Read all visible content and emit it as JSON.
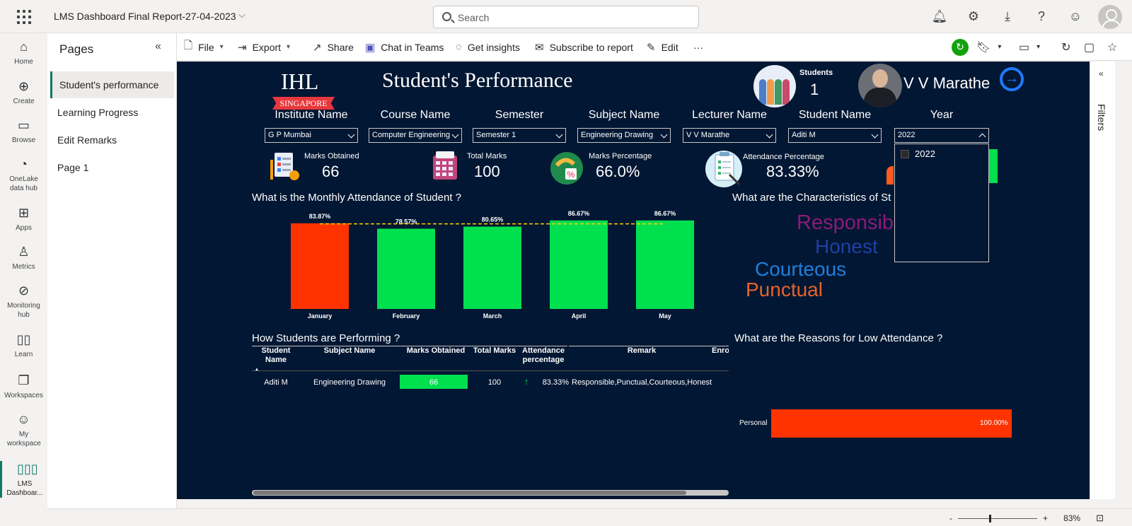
{
  "app": {
    "report_title": "LMS Dashboard Final Report-27-04-2023",
    "search_placeholder": "Search"
  },
  "leftnav": {
    "items": [
      {
        "label": "Home",
        "icon": "home-icon"
      },
      {
        "label": "Create",
        "icon": "plus-circle-icon"
      },
      {
        "label": "Browse",
        "icon": "folder-icon"
      },
      {
        "label": "OneLake data hub",
        "icon": "onelake-icon"
      },
      {
        "label": "Apps",
        "icon": "apps-icon"
      },
      {
        "label": "Metrics",
        "icon": "trophy-icon"
      },
      {
        "label": "Monitoring hub",
        "icon": "monitor-icon"
      },
      {
        "label": "Learn",
        "icon": "book-icon"
      },
      {
        "label": "Workspaces",
        "icon": "workspaces-icon"
      },
      {
        "label": "My workspace",
        "icon": "person-icon"
      },
      {
        "label": "LMS Dashboar...",
        "icon": "report-icon"
      }
    ]
  },
  "pages": {
    "title": "Pages",
    "items": [
      "Student's performance",
      "Learning Progress",
      "Edit Remarks",
      "Page 1"
    ],
    "active": 0
  },
  "actionbar": {
    "file": "File",
    "export": "Export",
    "share": "Share",
    "chat": "Chat in Teams",
    "insights": "Get insights",
    "subscribe": "Subscribe to report",
    "edit": "Edit",
    "more": "···"
  },
  "filters_pane": {
    "label": "Filters"
  },
  "status": {
    "zoom": "83%",
    "minus": "-",
    "plus": "+"
  },
  "report": {
    "logo_text": "IHL",
    "logo_ribbon": "SINGAPORE",
    "heading": "Student's Performance",
    "students_label": "Students",
    "students_value": "1",
    "lecturer_name": "V V Marathe",
    "slicers": [
      {
        "title": "Institute Name",
        "value": "G P Mumbai"
      },
      {
        "title": "Course Name",
        "value": "Computer Engineering"
      },
      {
        "title": "Semester",
        "value": "Semester 1"
      },
      {
        "title": "Subject Name",
        "value": "Engineering Drawing"
      },
      {
        "title": "Lecturer Name",
        "value": "V V Marathe"
      },
      {
        "title": "Student Name",
        "value": "Aditi M"
      },
      {
        "title": "Year",
        "value": "2022"
      }
    ],
    "year_dropdown_option": "2022",
    "kpis": [
      {
        "label": "Marks Obtained",
        "value": "66"
      },
      {
        "label": "Total Marks",
        "value": "100"
      },
      {
        "label": "Marks Percentage",
        "value": "66.0%"
      },
      {
        "label": "Attendance Percentage",
        "value": "83.33%"
      }
    ],
    "section_titles": {
      "attendance": "What is the Monthly Attendance of Student ?",
      "characteristics": "What are the Characteristics of St",
      "performing": "How Students are Performing ?",
      "low_attendance": "What are the Reasons for Low Attendance ?"
    },
    "table": {
      "headers": [
        "Student Name",
        "Subject Name",
        "Marks Obtained",
        "Total Marks",
        "Attendance percentage",
        "Remark",
        "Enro"
      ],
      "row": {
        "student": "Aditi M",
        "subject": "Engineering Drawing",
        "marks": "66",
        "total": "100",
        "attendance": "83.33%",
        "remark": "Responsible,Punctual,Courteous,Honest"
      }
    },
    "word_cloud": [
      {
        "word": "Responsib",
        "color": "#8b1a7a"
      },
      {
        "word": "Honest",
        "color": "#1f3fa8"
      },
      {
        "word": "Courteous",
        "color": "#1f7fdc"
      },
      {
        "word": "Punctual",
        "color": "#e8642a"
      }
    ],
    "low_attendance": {
      "category": "Personal",
      "value_label": "100.00%",
      "value": 1.0,
      "color": "#ff3300"
    }
  },
  "chart_data": {
    "type": "bar",
    "categories": [
      "January",
      "February",
      "March",
      "April",
      "May"
    ],
    "values": [
      83.87,
      78.57,
      80.65,
      86.67,
      86.67
    ],
    "labels": [
      "83.87%",
      "78.57%",
      "80.65%",
      "86.67%",
      "86.67%"
    ],
    "colors": [
      "#ff3300",
      "#00e04f",
      "#00e04f",
      "#00e04f",
      "#00e04f"
    ],
    "reference_line": {
      "value": 83.33,
      "color": "#ffd400",
      "style": "dashed"
    },
    "ylim": [
      0,
      90
    ],
    "grid": false,
    "title": "What is the Monthly Attendance of Student ?"
  }
}
